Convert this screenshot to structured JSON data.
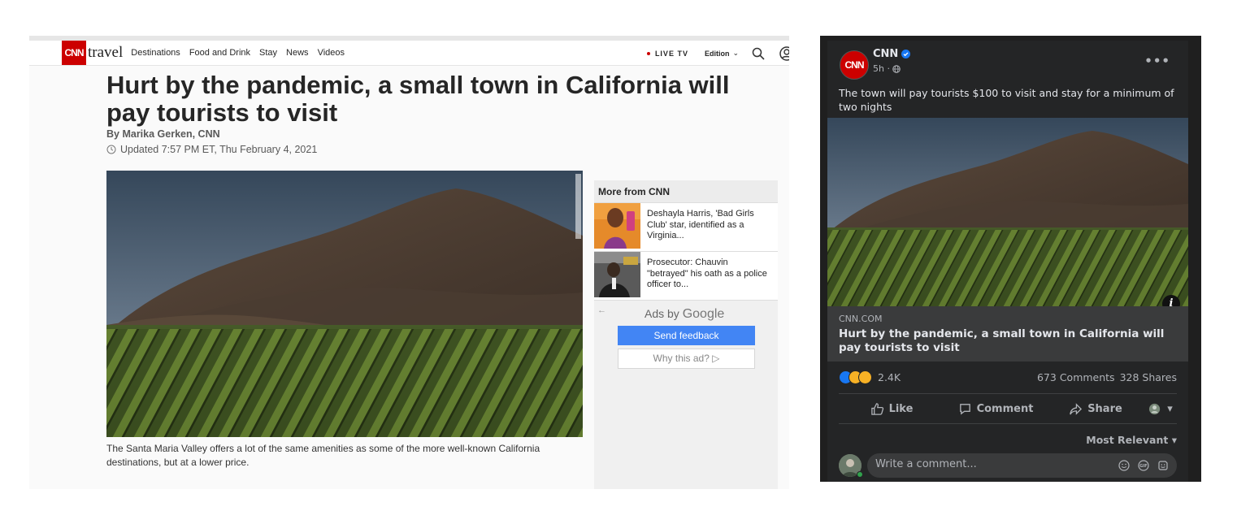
{
  "article": {
    "brand": {
      "logo_text": "CNN",
      "section": "travel"
    },
    "nav": [
      "Destinations",
      "Food and Drink",
      "Stay",
      "News",
      "Videos"
    ],
    "live_tv": "LIVE TV",
    "edition": "Edition",
    "headline": "Hurt by the pandemic, a small town in California will pay tourists to visit",
    "byline": "By Marika Gerken, CNN",
    "updated": "Updated 7:57 PM ET, Thu February 4, 2021",
    "caption": "The Santa Maria Valley offers a lot of the same amenities as some of the more well-known California destinations, but at a lower price.",
    "more_from": {
      "heading": "More from CNN",
      "items": [
        {
          "text": "Deshayla Harris, 'Bad Girls Club' star, identified as a Virginia..."
        },
        {
          "text": "Prosecutor: Chauvin \"betrayed\" his oath as a police officer to..."
        }
      ]
    },
    "ads": {
      "back": "←",
      "by": "Ads by",
      "google": "Google",
      "send_feedback": "Send feedback",
      "why_ad": "Why this ad? ▷"
    }
  },
  "facebook": {
    "page_name": "CNN",
    "avatar_text": "CNN",
    "time": "5h ·",
    "more": "•••",
    "post_text": "The town will pay tourists $100 to visit and stay for a minimum of two nights",
    "link_domain": "CNN.COM",
    "link_title": "Hurt by the pandemic, a small town in California will pay tourists to visit",
    "info": "i",
    "reaction_count": "2.4K",
    "comments": "673 Comments",
    "shares": "328 Shares",
    "actions": {
      "like": "Like",
      "comment": "Comment",
      "share": "Share"
    },
    "most_relevant": "Most Relevant ▾",
    "comment_placeholder": "Write a comment...",
    "colors": {
      "like_blue": "#1877f2",
      "wow_yellow": "#f7b125",
      "love_red": "#f33e58"
    }
  }
}
